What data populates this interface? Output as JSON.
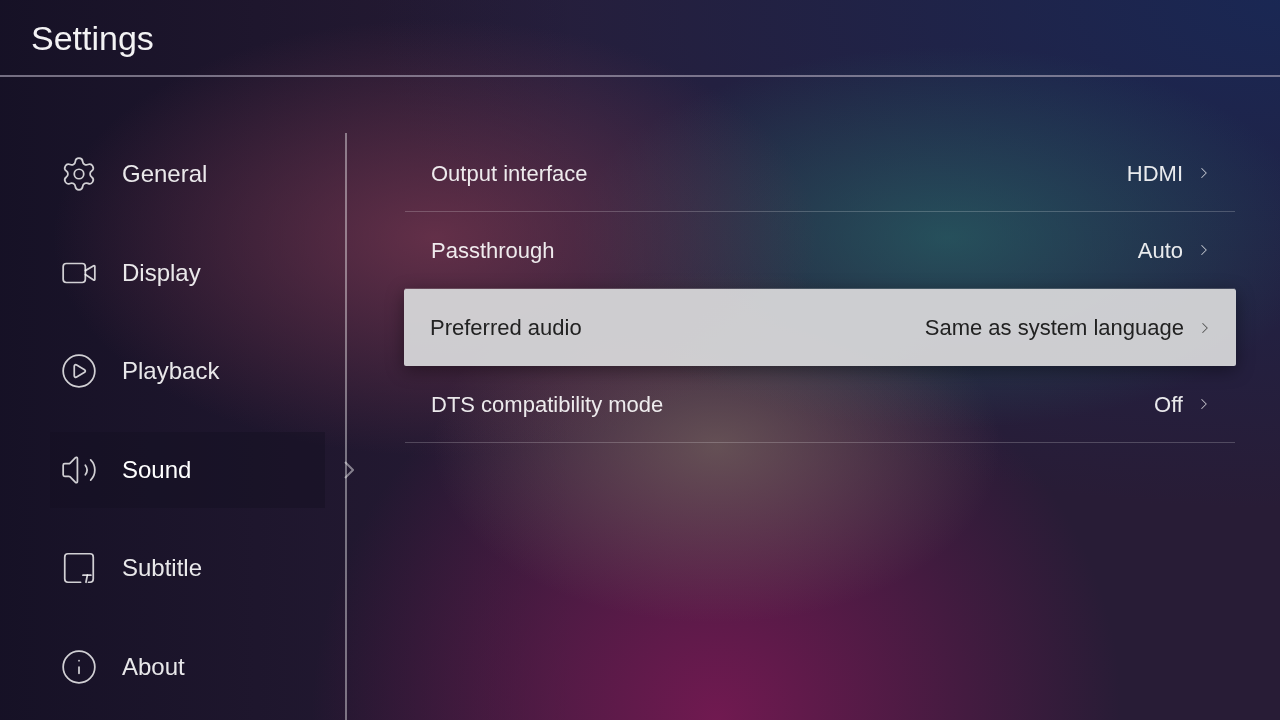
{
  "header": {
    "title": "Settings"
  },
  "sidebar": {
    "items": [
      {
        "label": "General",
        "selected": false
      },
      {
        "label": "Display",
        "selected": false
      },
      {
        "label": "Playback",
        "selected": false
      },
      {
        "label": "Sound",
        "selected": true
      },
      {
        "label": "Subtitle",
        "selected": false
      },
      {
        "label": "About",
        "selected": false
      }
    ]
  },
  "sound_settings": {
    "rows": [
      {
        "label": "Output interface",
        "value": "HDMI",
        "selected": false
      },
      {
        "label": "Passthrough",
        "value": "Auto",
        "selected": false
      },
      {
        "label": "Preferred audio",
        "value": "Same as system language",
        "selected": true
      },
      {
        "label": "DTS compatibility mode",
        "value": "Off",
        "selected": false
      }
    ]
  }
}
